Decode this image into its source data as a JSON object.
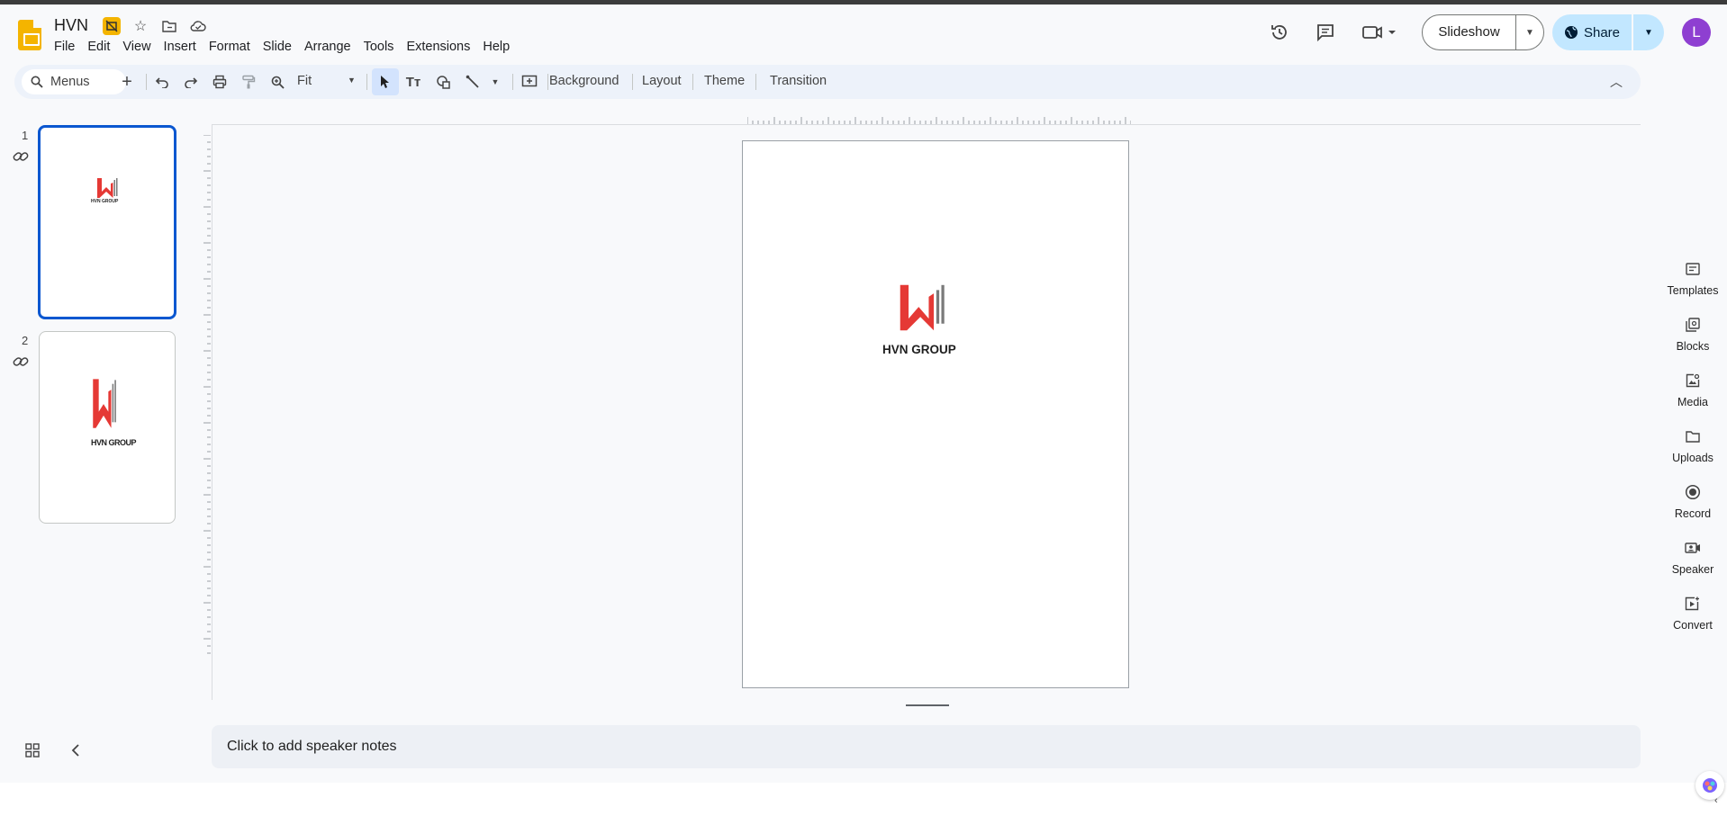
{
  "app": {
    "title": "HVN",
    "user_initial": "L"
  },
  "menus": [
    "File",
    "Edit",
    "View",
    "Insert",
    "Format",
    "Slide",
    "Arrange",
    "Tools",
    "Extensions",
    "Help"
  ],
  "header": {
    "slideshow_label": "Slideshow",
    "share_label": "Share"
  },
  "toolbar": {
    "search_label": "Menus",
    "zoom_value": "Fit",
    "background_label": "Background",
    "layout_label": "Layout",
    "theme_label": "Theme",
    "transition_label": "Transition"
  },
  "slides": [
    {
      "number": "1",
      "logo_text": "HVN GROUP"
    },
    {
      "number": "2",
      "logo_text": "HVN GROUP"
    }
  ],
  "canvas": {
    "logo_text": "HVN GROUP"
  },
  "notes": {
    "placeholder": "Click to add speaker notes"
  },
  "side_panel": [
    "Templates",
    "Blocks",
    "Media",
    "Uploads",
    "Record",
    "Speaker",
    "Convert"
  ],
  "colors": {
    "accent": "#0b57d0",
    "share_bg": "#c2e7ff",
    "avatar_bg": "#8e3fd1",
    "logo_red": "#e53935",
    "logo_gray": "#7a7a7a"
  }
}
